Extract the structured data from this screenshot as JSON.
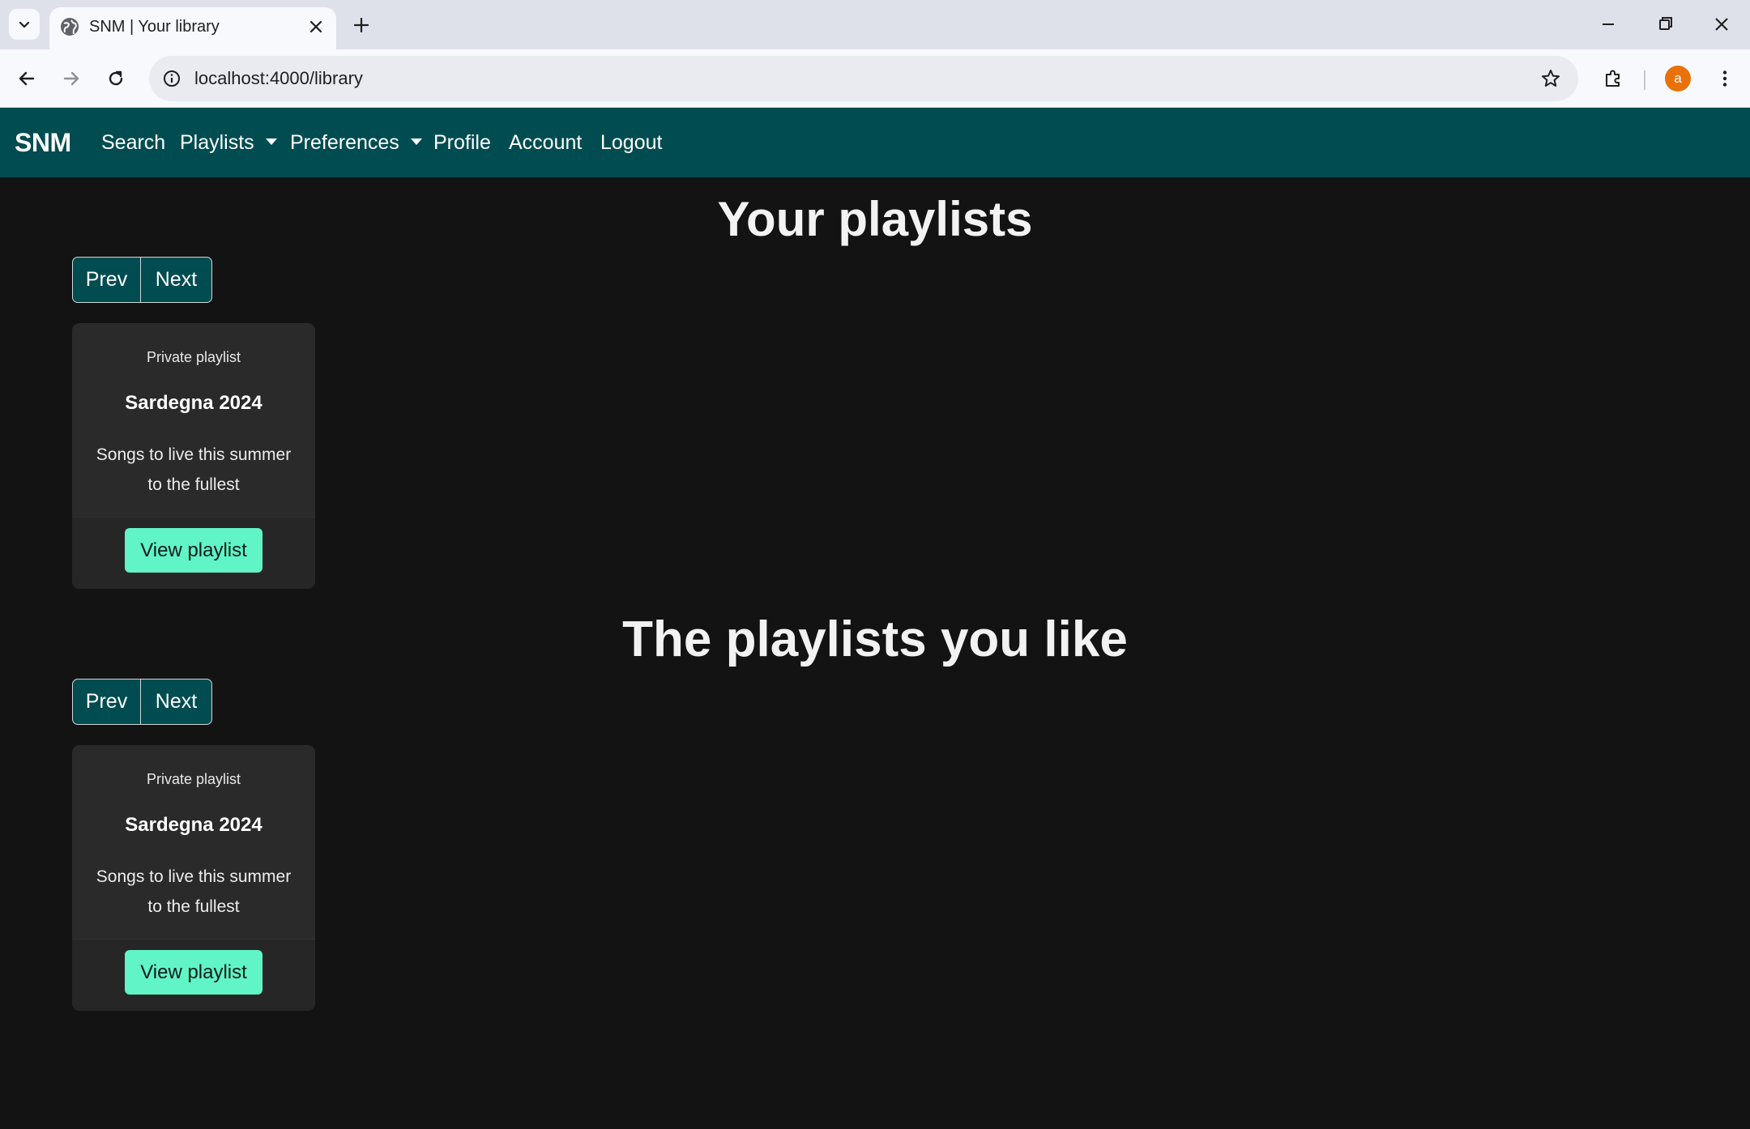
{
  "browser": {
    "tab_title": "SNM | Your library",
    "url": "localhost:4000/library",
    "profile_initial": "a"
  },
  "navbar": {
    "brand": "SNM",
    "links": [
      "Search",
      "Playlists",
      "Preferences",
      "Profile",
      "Account",
      "Logout"
    ]
  },
  "your_playlists": {
    "title": "Your playlists",
    "pager": {
      "prev": "Prev",
      "next": "Next"
    },
    "cards": [
      {
        "visibility": "Private playlist",
        "name": "Sardegna 2024",
        "description": "Songs to live this summer to the fullest",
        "button": "View playlist"
      }
    ]
  },
  "liked_playlists": {
    "title": "The playlists you like",
    "pager": {
      "prev": "Prev",
      "next": "Next"
    },
    "cards": [
      {
        "visibility": "Private playlist",
        "name": "Sardegna 2024",
        "description": "Songs to live this summer to the fullest",
        "button": "View playlist"
      }
    ]
  },
  "colors": {
    "navbar": "#004c50",
    "page_background": "#131313",
    "card_background": "#2a2a2a",
    "view_button": "#60f4c6",
    "profile_avatar": "#e8710a"
  },
  "icons": [
    "tab-search-icon",
    "globe-icon",
    "close-icon",
    "plus-icon",
    "minimize-icon",
    "restore-icon",
    "back-arrow-icon",
    "forward-arrow-icon",
    "reload-icon",
    "site-info-icon",
    "star-icon",
    "extensions-icon",
    "kebab-menu-icon",
    "caret-down-icon"
  ]
}
